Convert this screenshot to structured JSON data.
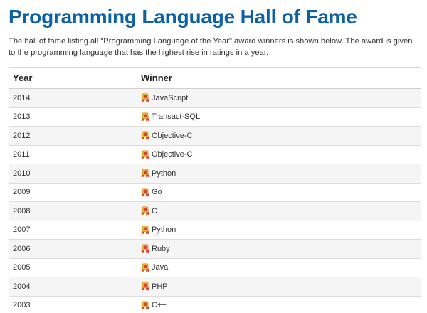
{
  "page": {
    "title": "Programming Language Hall of Fame",
    "intro": "The hall of fame listing all \"Programming Language of the Year\" award winners is shown below. The award is given to the programming language that has the highest rise in ratings in a year."
  },
  "table": {
    "headers": {
      "year": "Year",
      "winner": "Winner"
    },
    "award_icon": "award-medal-icon",
    "rows": [
      {
        "year": "2014",
        "winner": "JavaScript"
      },
      {
        "year": "2013",
        "winner": "Transact-SQL"
      },
      {
        "year": "2012",
        "winner": "Objective-C"
      },
      {
        "year": "2011",
        "winner": "Objective-C"
      },
      {
        "year": "2010",
        "winner": "Python"
      },
      {
        "year": "2009",
        "winner": "Go"
      },
      {
        "year": "2008",
        "winner": "C"
      },
      {
        "year": "2007",
        "winner": "Python"
      },
      {
        "year": "2006",
        "winner": "Ruby"
      },
      {
        "year": "2005",
        "winner": "Java"
      },
      {
        "year": "2004",
        "winner": "PHP"
      },
      {
        "year": "2003",
        "winner": "C++"
      }
    ]
  },
  "colors": {
    "title": "#0b61a4",
    "medal_gold": "#f3c13a",
    "ribbon_red": "#d9412e"
  }
}
